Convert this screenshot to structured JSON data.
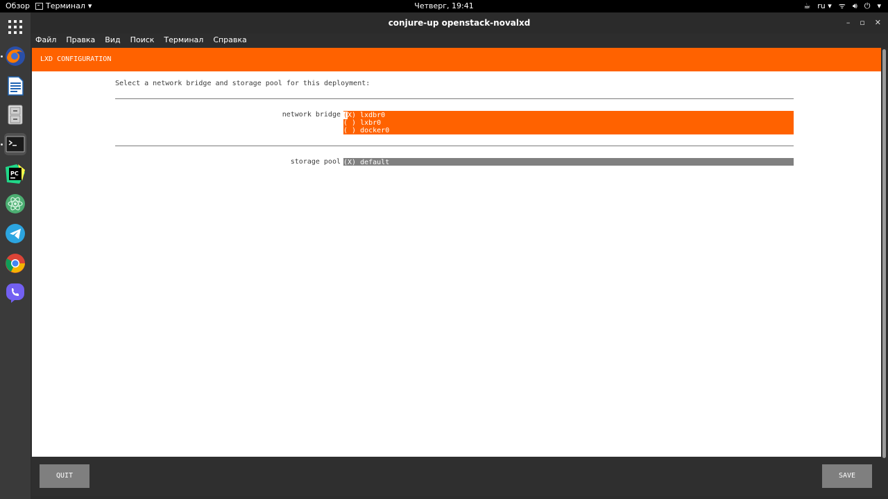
{
  "topbar": {
    "activities": "Обзор",
    "app_menu": "Терминал",
    "clock": "Четверг, 19:41",
    "lang": "ru"
  },
  "dock": {
    "apps": [
      "firefox-icon",
      "libreoffice-writer-icon",
      "file-cabinet-icon",
      "terminal-icon",
      "pycharm-icon",
      "atom-icon",
      "telegram-icon",
      "chrome-icon",
      "viber-icon"
    ]
  },
  "window": {
    "title": "conjure-up openstack-novalxd",
    "menu": [
      "Файл",
      "Правка",
      "Вид",
      "Поиск",
      "Терминал",
      "Справка"
    ]
  },
  "screen": {
    "header": "LXD CONFIGURATION",
    "prompt": "Select a network bridge and storage pool for this deployment:",
    "network_bridge": {
      "label": "network bridge",
      "options": [
        "(X) lxdbr0",
        "( ) lxbr0",
        "( ) docker0"
      ]
    },
    "storage_pool": {
      "label": "storage pool",
      "options": [
        "(X) default"
      ]
    },
    "buttons": {
      "quit": "QUIT",
      "save": "SAVE"
    }
  },
  "colors": {
    "accent": "#ff6200",
    "button": "#7f7f7f",
    "footer": "#2f2f2f"
  }
}
